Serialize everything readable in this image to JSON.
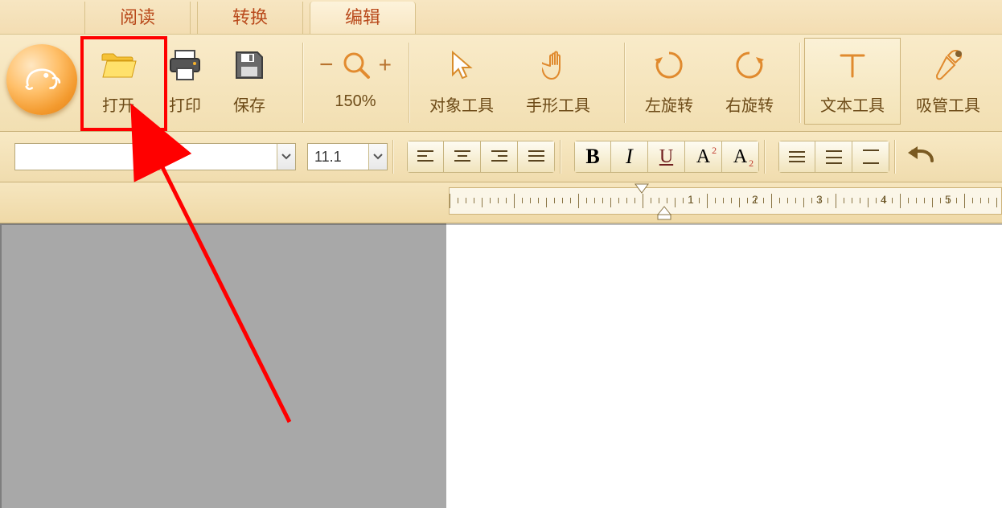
{
  "tabs": {
    "read": {
      "label": "阅读"
    },
    "convert": {
      "label": "转换"
    },
    "edit": {
      "label": "编辑"
    }
  },
  "ribbon": {
    "open": {
      "label": "打开"
    },
    "print": {
      "label": "打印"
    },
    "save": {
      "label": "保存"
    },
    "zoom": {
      "label": "150%"
    },
    "select": {
      "label": "对象工具"
    },
    "hand": {
      "label": "手形工具"
    },
    "rotleft": {
      "label": "左旋转"
    },
    "rotright": {
      "label": "右旋转"
    },
    "text": {
      "label": "文本工具"
    },
    "pipette": {
      "label": "吸管工具"
    }
  },
  "toolbar": {
    "font_name": "",
    "font_size": "11.1",
    "bold": "B",
    "italic": "I",
    "underline": "U",
    "sup": "A",
    "sub": "A"
  },
  "ruler": {
    "marks": [
      "1",
      "2",
      "3",
      "4",
      "5"
    ]
  }
}
